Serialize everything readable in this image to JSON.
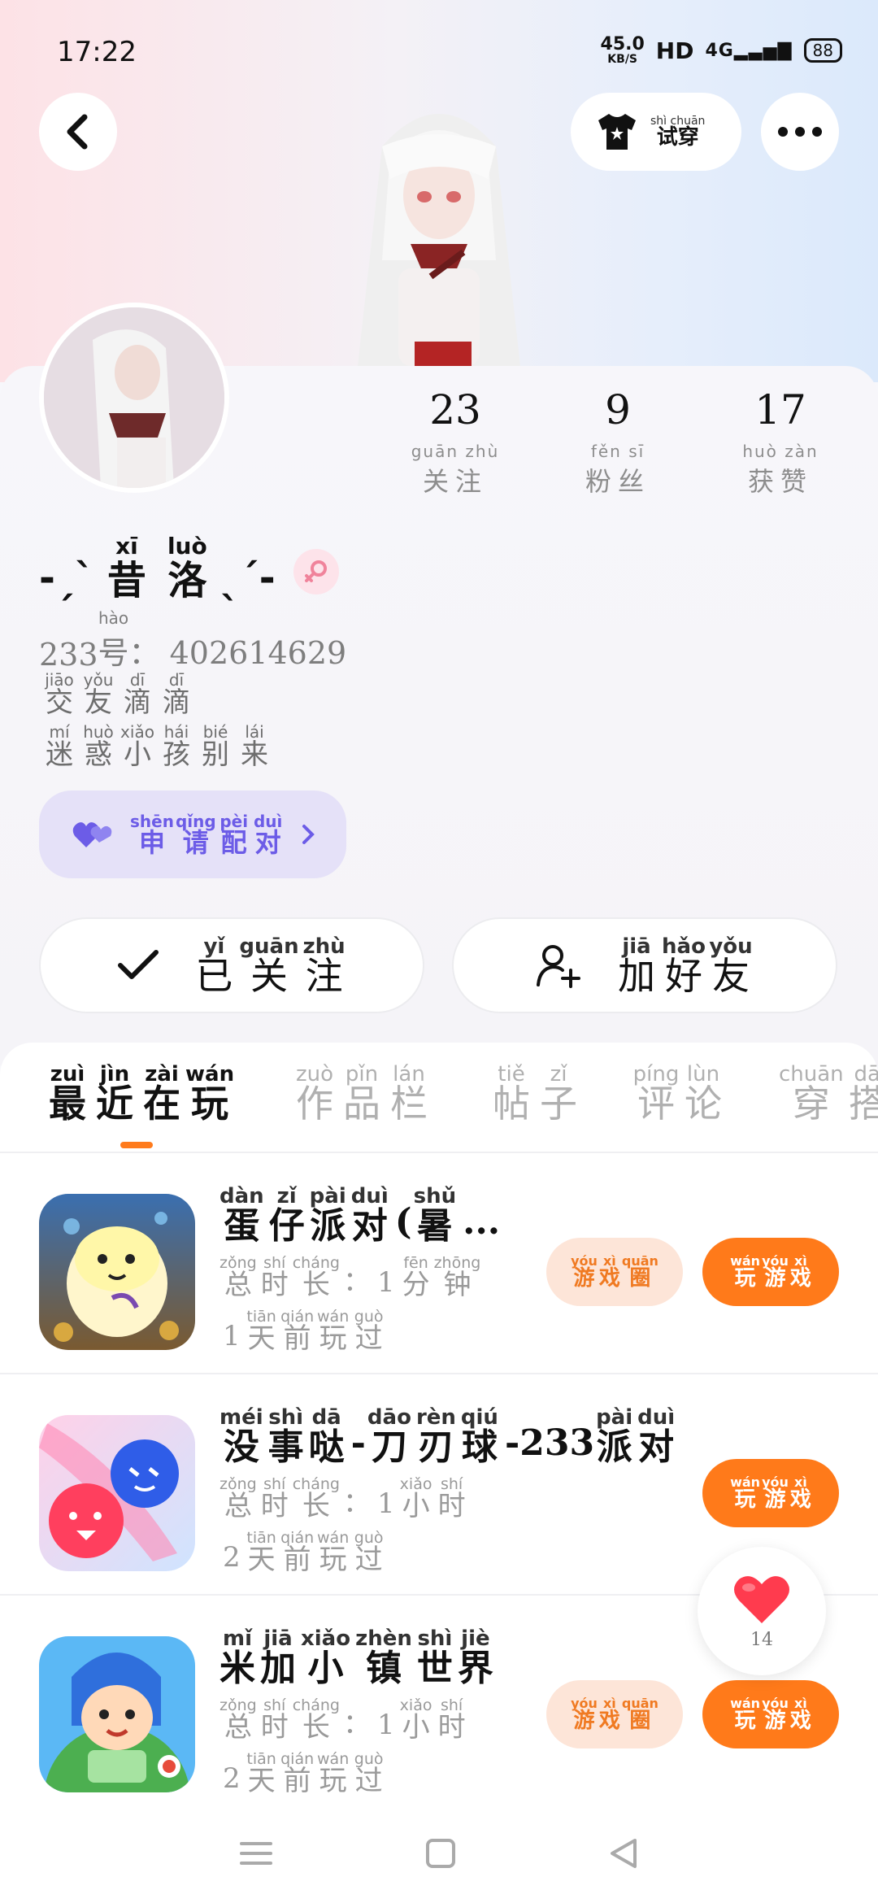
{
  "status_bar": {
    "time": "17:22",
    "speed_value": "45.0",
    "speed_unit": "KB/S",
    "hd": "HD",
    "network": "4G",
    "battery": "88"
  },
  "header": {
    "try_on_py": "shì chuān",
    "try_on_hz": "试穿"
  },
  "stats": [
    {
      "value": "23",
      "py": "guān zhù",
      "hz": "关注"
    },
    {
      "value": "9",
      "py": "fěn sī",
      "hz": "粉丝"
    },
    {
      "value": "17",
      "py": "huò zàn",
      "hz": "获赞"
    }
  ],
  "profile": {
    "nick_left": "-ˏˋ",
    "nick_right": "ˎˊ-",
    "nick_chars": [
      {
        "py": "xī",
        "hz": "昔"
      },
      {
        "py": "luò",
        "hz": "洛"
      }
    ],
    "uid_prefix": "233",
    "uid_hao_py": "hào",
    "uid_hao_hz": "号",
    "uid_value": "： 402614629",
    "bio_line1": [
      {
        "py": "jiāo",
        "hz": "交"
      },
      {
        "py": "yǒu",
        "hz": "友"
      },
      {
        "py": "dī",
        "hz": "滴"
      },
      {
        "py": "dī",
        "hz": "滴"
      }
    ],
    "bio_line2": [
      {
        "py": "mí",
        "hz": "迷"
      },
      {
        "py": "huò",
        "hz": "惑"
      },
      {
        "py": "xiǎo",
        "hz": "小"
      },
      {
        "py": "hái",
        "hz": "孩"
      },
      {
        "py": "bié",
        "hz": "别"
      },
      {
        "py": "lái",
        "hz": "来"
      }
    ]
  },
  "pair_button": [
    {
      "py": "shēn",
      "hz": "申"
    },
    {
      "py": "qǐng",
      "hz": "请"
    },
    {
      "py": "pèi",
      "hz": "配"
    },
    {
      "py": "duì",
      "hz": "对"
    }
  ],
  "follow_button": [
    {
      "py": "yǐ",
      "hz": "已"
    },
    {
      "py": "guān",
      "hz": "关"
    },
    {
      "py": "zhù",
      "hz": "注"
    }
  ],
  "friend_button": [
    {
      "py": "jiā",
      "hz": "加"
    },
    {
      "py": "hǎo",
      "hz": "好"
    },
    {
      "py": "yǒu",
      "hz": "友"
    }
  ],
  "tabs": [
    {
      "chars": [
        {
          "py": "zuì",
          "hz": "最"
        },
        {
          "py": "jìn",
          "hz": "近"
        },
        {
          "py": "zài",
          "hz": "在"
        },
        {
          "py": "wán",
          "hz": "玩"
        }
      ],
      "active": true
    },
    {
      "chars": [
        {
          "py": "zuò",
          "hz": "作"
        },
        {
          "py": "pǐn",
          "hz": "品"
        },
        {
          "py": "lán",
          "hz": "栏"
        }
      ],
      "active": false
    },
    {
      "chars": [
        {
          "py": "tiě",
          "hz": "帖"
        },
        {
          "py": "zǐ",
          "hz": "子"
        }
      ],
      "active": false
    },
    {
      "chars": [
        {
          "py": "píng",
          "hz": "评"
        },
        {
          "py": "lùn",
          "hz": "论"
        }
      ],
      "active": false
    },
    {
      "chars": [
        {
          "py": "chuān",
          "hz": "穿"
        },
        {
          "py": "dā",
          "hz": "搭"
        }
      ],
      "active": false
    }
  ],
  "games": [
    {
      "title": [
        {
          "py": "dàn",
          "hz": "蛋"
        },
        {
          "py": "zǐ",
          "hz": "仔"
        },
        {
          "py": "pài",
          "hz": "派"
        },
        {
          "py": "duì",
          "hz": "对"
        },
        {
          "plain": "("
        },
        {
          "py": "shǔ",
          "hz": "暑"
        },
        {
          "plain": "..."
        }
      ],
      "duration_num": "1",
      "duration_unit": [
        {
          "py": "fēn",
          "hz": "分"
        },
        {
          "py": "zhōng",
          "hz": "钟"
        }
      ],
      "days_num": "1",
      "has_circle": true
    },
    {
      "title": [
        {
          "py": "méi",
          "hz": "没"
        },
        {
          "py": "shì",
          "hz": "事"
        },
        {
          "py": "dā",
          "hz": "哒"
        },
        {
          "plain": "-"
        },
        {
          "py": "dāo",
          "hz": "刀"
        },
        {
          "py": "rèn",
          "hz": "刃"
        },
        {
          "py": "qiú",
          "hz": "球"
        },
        {
          "plain": "-233"
        },
        {
          "py": "pài",
          "hz": "派"
        },
        {
          "py": "duì",
          "hz": "对"
        }
      ],
      "duration_num": "1",
      "duration_unit": [
        {
          "py": "xiǎo",
          "hz": "小"
        },
        {
          "py": "shí",
          "hz": "时"
        }
      ],
      "days_num": "2",
      "has_circle": false
    },
    {
      "title": [
        {
          "py": "mǐ",
          "hz": "米"
        },
        {
          "py": "jiā",
          "hz": "加"
        },
        {
          "py": "xiǎo",
          "hz": "小"
        },
        {
          "py": "zhèn",
          "hz": "镇"
        },
        {
          "py": "shì",
          "hz": "世"
        },
        {
          "py": "jiè",
          "hz": "界"
        }
      ],
      "duration_num": "1",
      "duration_unit": [
        {
          "py": "xiǎo",
          "hz": "小"
        },
        {
          "py": "shí",
          "hz": "时"
        }
      ],
      "days_num": "2",
      "has_circle": true
    }
  ],
  "meta_labels": {
    "total_time": [
      {
        "py": "zǒng",
        "hz": "总"
      },
      {
        "py": "shí",
        "hz": "时"
      },
      {
        "py": "cháng",
        "hz": "长"
      }
    ],
    "colon": "：",
    "days_ago": [
      {
        "py": "tiān",
        "hz": "天"
      },
      {
        "py": "qián",
        "hz": "前"
      },
      {
        "py": "wán",
        "hz": "玩"
      },
      {
        "py": "guò",
        "hz": "过"
      }
    ]
  },
  "pill_labels": {
    "circle": [
      {
        "py": "yóu",
        "hz": "游"
      },
      {
        "py": "xì",
        "hz": "戏"
      },
      {
        "py": "quān",
        "hz": "圈"
      }
    ],
    "play": [
      {
        "py": "wán",
        "hz": "玩"
      },
      {
        "py": "yóu",
        "hz": "游"
      },
      {
        "py": "xì",
        "hz": "戏"
      }
    ]
  },
  "like_float": {
    "count": "14"
  },
  "colors": {
    "accent": "#ff7a1a",
    "pair": "#6c5ce7",
    "like": "#ff3b4e"
  }
}
